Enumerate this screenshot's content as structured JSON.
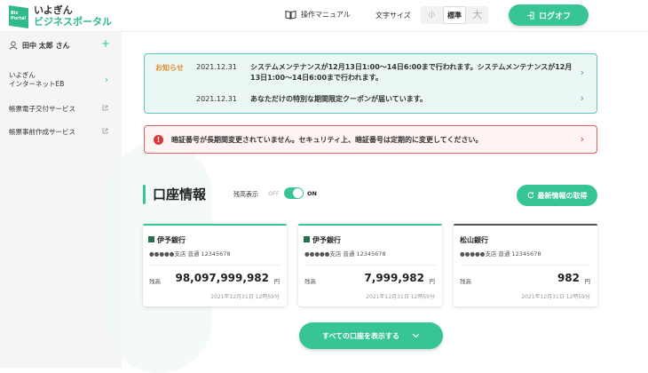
{
  "header": {
    "logo": {
      "mark_line1": "Biz",
      "mark_line2": "Portal",
      "line1": "いよぎん",
      "line2": "ビジネスポータル"
    },
    "manual_label": "操作マニュアル",
    "font_size": {
      "label": "文字サイズ",
      "options": [
        "小",
        "標準",
        "大"
      ],
      "selected": "標準"
    },
    "logout_label": "ログオフ"
  },
  "sidebar": {
    "user_name": "田中 太郎 さん",
    "items": [
      {
        "label_line1": "いよぎん",
        "label_line2": "インターネットEB",
        "type": "chevron"
      },
      {
        "label_line1": "帳票電子交付サービス",
        "type": "external"
      },
      {
        "label_line1": "帳票事前作成サービス",
        "type": "external"
      }
    ]
  },
  "notices": {
    "label": "お知らせ",
    "items": [
      {
        "date": "2021.12.31",
        "text": "システムメンテナンスが12月13日1:00〜14日6:00まで行われます。システムメンテナンスが12月13日1:00〜14日6:00まで行われます。"
      },
      {
        "date": "2021.12.31",
        "text": "あなただけの特別な期間限定クーポンが届いています。"
      }
    ]
  },
  "alert": {
    "icon": "!",
    "text": "暗証番号が長期間変更されていません。セキュリティ上、暗証番号は定期的に変更してください。"
  },
  "accounts": {
    "title": "口座情報",
    "balance_toggle": {
      "label": "残高表示",
      "off": "OFF",
      "on": "ON",
      "state": "on"
    },
    "refresh_label": "最新情報の取得",
    "cards": [
      {
        "bank": "伊予銀行",
        "account": "●●●●●支店 普通 12345678",
        "balance_label": "残高",
        "balance": "98,097,999,982",
        "unit": "円",
        "timestamp": "2021年12月31日 12時59分",
        "accent": "#37c496"
      },
      {
        "bank": "伊予銀行",
        "account": "●●●●●支店 普通 12345678",
        "balance_label": "残高",
        "balance": "7,999,982",
        "unit": "円",
        "timestamp": "2021年12月31日 12時59分",
        "accent": "#37c496"
      },
      {
        "bank": "松山銀行",
        "account": "●●●●●支店 普通 12345678",
        "balance_label": "残高",
        "balance": "982",
        "unit": "円",
        "timestamp": "2021年12月31日 12時59分",
        "accent": "#555555"
      }
    ],
    "show_all_label": "すべての口座を表示する"
  },
  "colors": {
    "brand": "#37c496",
    "alert": "#d53a3a",
    "notice_label": "#e08a2a"
  }
}
